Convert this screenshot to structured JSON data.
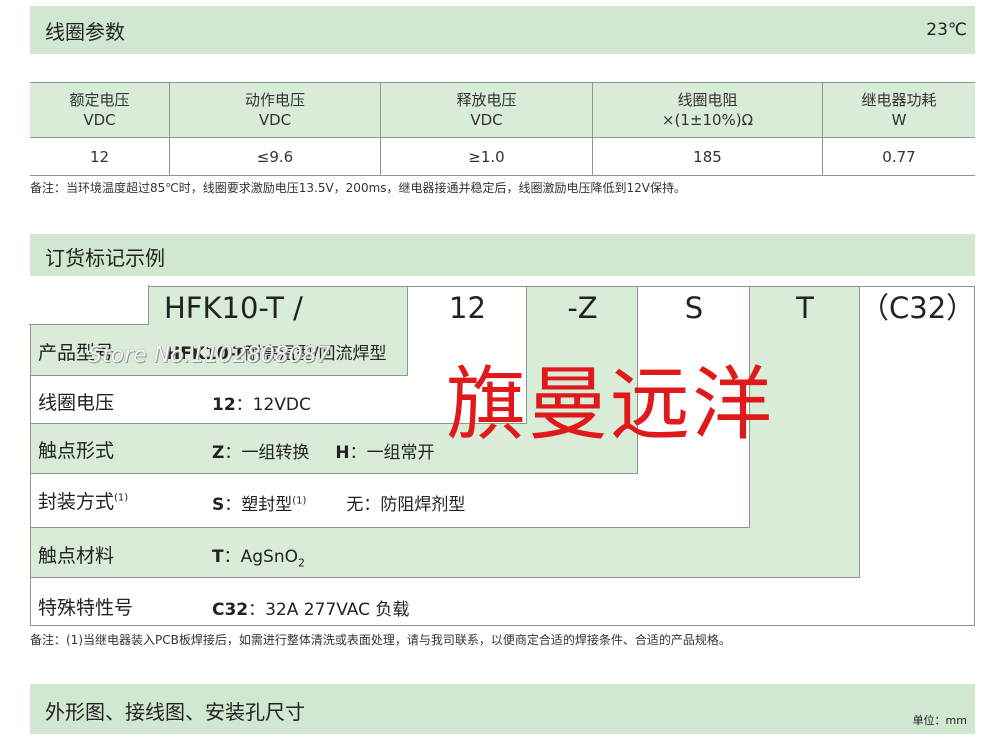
{
  "coil_section": {
    "title": "线圈参数",
    "temperature": "23℃"
  },
  "coil_table": {
    "headers": [
      {
        "line1": "额定电压",
        "line2": "VDC"
      },
      {
        "line1": "动作电压",
        "line2": "VDC"
      },
      {
        "line1": "释放电压",
        "line2": "VDC"
      },
      {
        "line1": "线圈电阻",
        "line2": "×(1±10%)Ω"
      },
      {
        "line1": "继电器功耗",
        "line2": "W"
      }
    ],
    "row": [
      "12",
      "≤9.6",
      "≥1.0",
      "185",
      "0.77"
    ]
  },
  "coil_note": "备注：当环境温度超过85℃时，线圈要求激励电压13.5V，200ms，继电器接通并稳定后，线圈激励电压降低到12V保持。",
  "order_section": {
    "title": "订货标记示例"
  },
  "order_codes": {
    "model": "HFK10-T /",
    "voltage": "12",
    "contact": "-Z",
    "package": "S",
    "material": "T",
    "special": "（C32）"
  },
  "order_rows": {
    "product": {
      "label": "产品型号",
      "code": "HFK10-T",
      "desc": "耐高温型/回流焊型"
    },
    "coil": {
      "label": "线圈电压",
      "code": "12",
      "desc": "12VDC"
    },
    "contact": {
      "label": "触点形式",
      "code1": "Z",
      "desc1": "一组转换",
      "code2": "H",
      "desc2": "一组常开"
    },
    "package": {
      "label": "封装方式",
      "label_sup": "(1)",
      "code": "S",
      "desc": "塑封型",
      "desc_sup": "(1)",
      "alt": "无：防阻焊剂型"
    },
    "material": {
      "label": "触点材料",
      "code": "T",
      "desc": "AgSnO",
      "desc_sub": "2"
    },
    "special": {
      "label": "特殊特性号",
      "code": "C32",
      "desc": "32A 277VAC 负载"
    }
  },
  "order_note": "备注：(1)当继电器装入PCB板焊接后，如需进行整体清洗或表面处理，请与我司联系，以便商定合适的焊接条件、合适的产品规格。",
  "outline_section": {
    "title": "外形图、接线图、安装孔尺寸",
    "unit": "单位：mm"
  },
  "watermarks": {
    "store": "Store No.1102808087",
    "brand": "旗曼远洋"
  },
  "colors": {
    "band": "#cfe8cf",
    "watermark_red": "#e01a1a"
  }
}
